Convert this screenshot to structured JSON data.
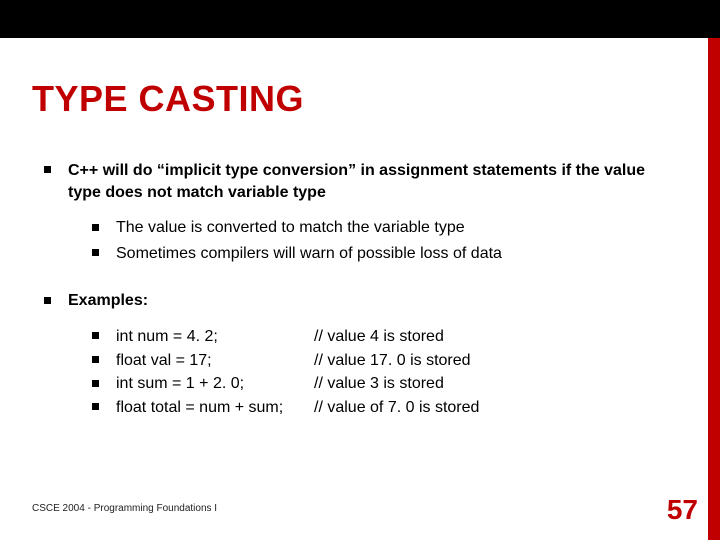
{
  "slide": {
    "title": "TYPE CASTING",
    "bullets": [
      {
        "text": "C++ will do “implicit type conversion” in assignment statements if the value type does not match variable type",
        "sub": [
          "The value is converted to match the variable type",
          "Sometimes compilers will warn of possible loss of data"
        ]
      },
      {
        "text": "Examples:",
        "examples": [
          {
            "code": "int num = 4. 2;",
            "comment": "// value 4 is stored"
          },
          {
            "code": "float val = 17;",
            "comment": "// value 17. 0 is stored"
          },
          {
            "code": "int sum = 1 + 2. 0;",
            "comment": "// value 3 is stored"
          },
          {
            "code": "float total = num + sum;",
            "comment": "// value of 7. 0 is stored"
          }
        ]
      }
    ],
    "footer": "CSCE 2004 - Programming Foundations I",
    "page_number": "57"
  }
}
